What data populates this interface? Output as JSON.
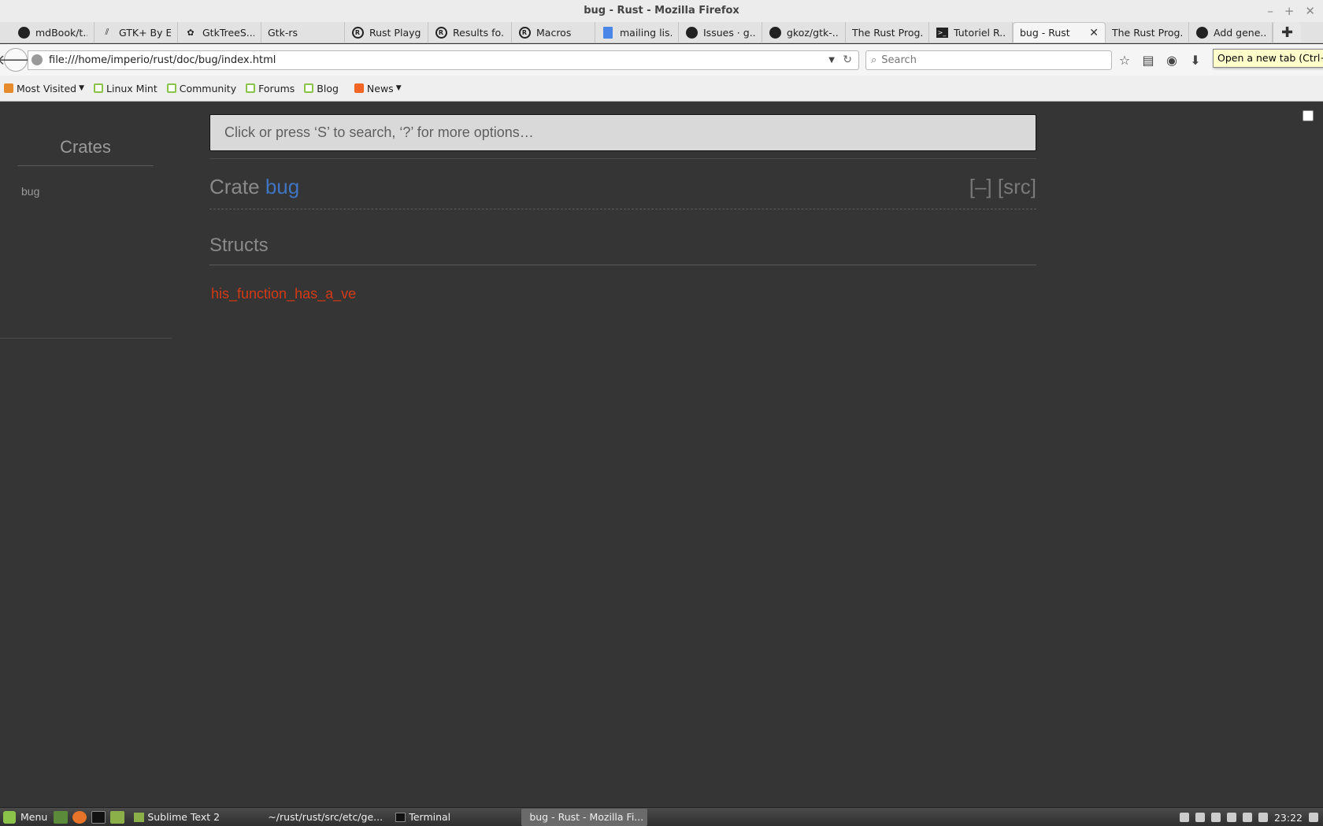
{
  "window": {
    "title": "bug - Rust - Mozilla Firefox",
    "controls": [
      "–",
      "+",
      "✕"
    ]
  },
  "tabs": [
    {
      "label": "mdBook/t...",
      "icon": "github-icon"
    },
    {
      "label": "GTK+ By E...",
      "icon": "gtk-icon"
    },
    {
      "label": "GtkTreeS...",
      "icon": "gnome-icon"
    },
    {
      "label": "Gtk-rs",
      "icon": ""
    },
    {
      "label": "Rust Playg...",
      "icon": "rust-icon"
    },
    {
      "label": "Results fo...",
      "icon": "rust-icon"
    },
    {
      "label": "Macros",
      "icon": "rust-icon"
    },
    {
      "label": "mailing lis...",
      "icon": "doc-icon"
    },
    {
      "label": "Issues · g...",
      "icon": "github-icon"
    },
    {
      "label": "gkoz/gtk-...",
      "icon": "github-icon"
    },
    {
      "label": "The Rust Prog...",
      "icon": ""
    },
    {
      "label": "Tutoriel R...",
      "icon": "terminal-icon"
    },
    {
      "label": "bug - Rust",
      "icon": "",
      "active": true
    },
    {
      "label": "The Rust Prog...",
      "icon": ""
    },
    {
      "label": "Add gene...",
      "icon": "github-icon"
    }
  ],
  "tab_close": "✕",
  "new_tab": "✚",
  "navbar": {
    "back": "🡐",
    "url": "file:///home/imperio/rust/doc/bug/index.html",
    "search_placeholder": "Search",
    "tooltip": "Open a new tab (Ctrl+T)"
  },
  "bookmarks": [
    {
      "label": "Most Visited",
      "dropdown": true,
      "icon": "most"
    },
    {
      "label": "Linux Mint",
      "icon": "mint"
    },
    {
      "label": "Community",
      "icon": "mint"
    },
    {
      "label": "Forums",
      "icon": "mint"
    },
    {
      "label": "Blog",
      "icon": "mint"
    },
    {
      "label": "News",
      "dropdown": true,
      "icon": "rss"
    }
  ],
  "doc": {
    "search_placeholder": "Click or press ‘S’ to search, ‘?’ for more options…",
    "sidebar_title": "Crates",
    "sidebar_crate": "bug",
    "heading_prefix": "Crate ",
    "crate_name": "bug",
    "collapse_toggle": "[–]",
    "src_link": "[src]",
    "structs_heading": "Structs",
    "struct_link": "his_function_has_a_ve",
    "colors": {
      "background": "#353535",
      "struct": "#d33a15",
      "crate": "#3f75c2"
    }
  },
  "taskbar": {
    "menu": "Menu",
    "tasks": [
      {
        "label": "Sublime Text 2",
        "icon": "folder"
      },
      {
        "label": "~/rust/rust/src/etc/ge...",
        "icon": "editor"
      },
      {
        "label": "Terminal",
        "icon": "terminal"
      },
      {
        "label": "bug - Rust - Mozilla Fi...",
        "icon": "firefox",
        "active": true
      }
    ],
    "clock": "23:22"
  }
}
